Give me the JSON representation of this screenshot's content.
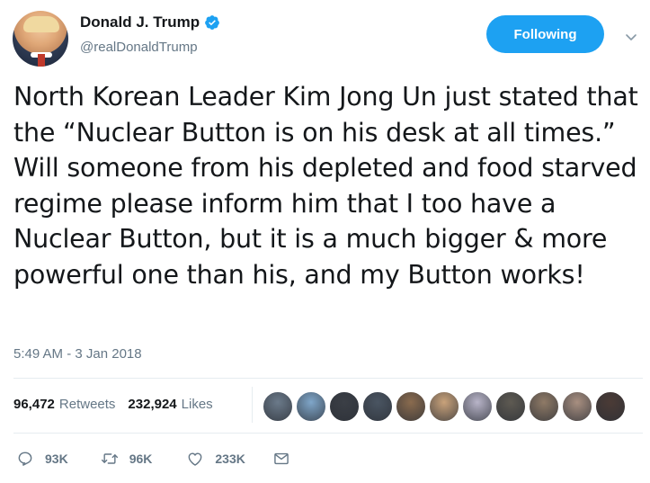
{
  "header": {
    "display_name": "Donald J. Trump",
    "handle": "@realDonaldTrump",
    "verified_icon": "verified-badge-icon",
    "follow_button_label": "Following",
    "caret_icon": "chevron-down-icon"
  },
  "tweet": {
    "text": "North Korean Leader Kim Jong Un just stated that the “Nuclear Button is on his desk at all times.” Will someone from his depleted and food starved regime please inform him that I too have a Nuclear Button, but it is a much bigger & more powerful one than his, and my Button works!",
    "timestamp": "5:49 AM - 3 Jan 2018"
  },
  "stats": {
    "retweets_count": "96,472",
    "retweets_label": "Retweets",
    "likes_count": "232,924",
    "likes_label": "Likes"
  },
  "likers": [
    {
      "color": "#6b7a8a"
    },
    {
      "color": "#7fa6c9"
    },
    {
      "color": "#3b3f46"
    },
    {
      "color": "#4a5562"
    },
    {
      "color": "#8a6b4e"
    },
    {
      "color": "#c9a27a"
    },
    {
      "color": "#b8b4c8"
    },
    {
      "color": "#5e5a52"
    },
    {
      "color": "#8f7a66"
    },
    {
      "color": "#a88f80"
    },
    {
      "color": "#4b3b36"
    }
  ],
  "actions": {
    "reply_count": "93K",
    "retweet_count": "96K",
    "like_count": "233K",
    "reply_icon": "reply-icon",
    "retweet_icon": "retweet-icon",
    "like_icon": "heart-icon",
    "dm_icon": "envelope-icon"
  },
  "colors": {
    "accent": "#1da1f2",
    "text_primary": "#14171a",
    "text_secondary": "#657786",
    "divider": "#e6ecf0"
  }
}
